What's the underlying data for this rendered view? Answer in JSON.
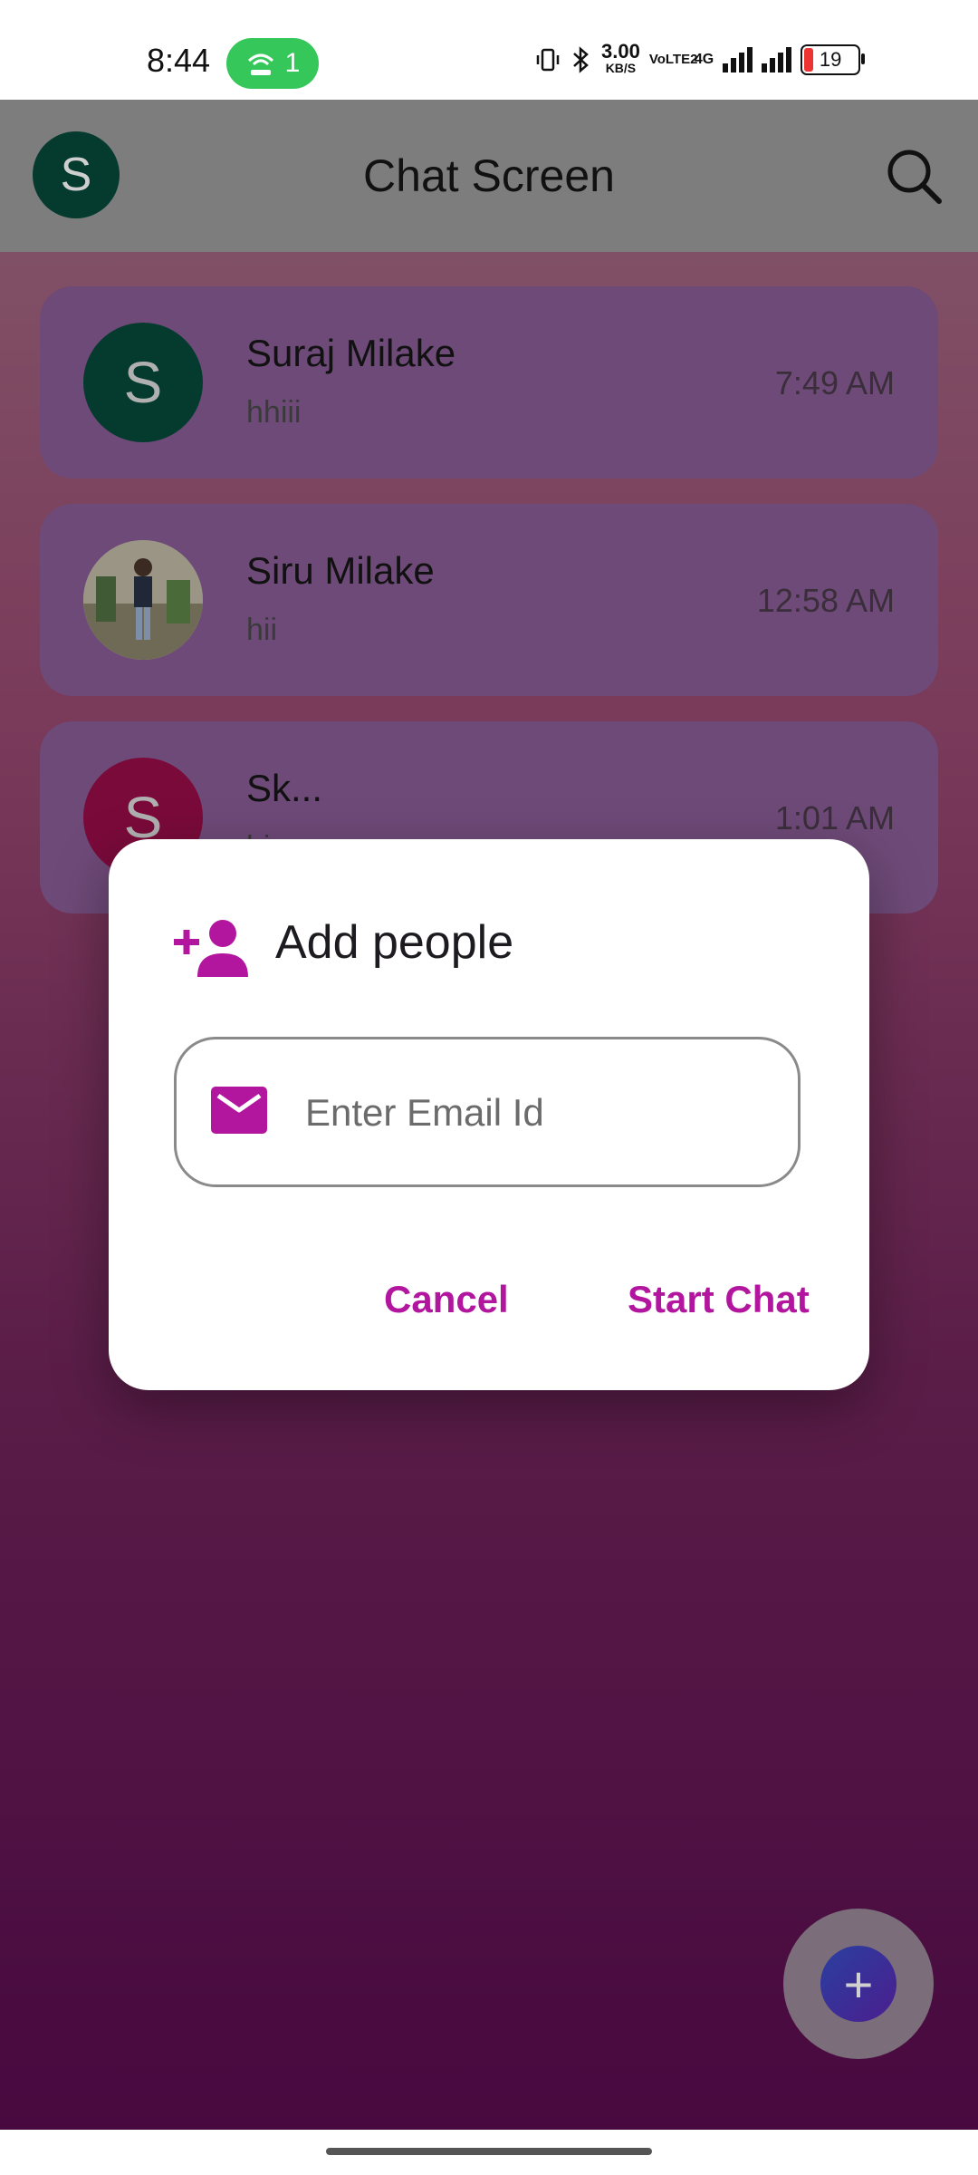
{
  "status_bar": {
    "time": "8:44",
    "hotspot_count": "1",
    "net_speed": "3.00",
    "net_speed_unit": "KB/S",
    "volte": "VoLTE2",
    "network": "4G",
    "battery": "19"
  },
  "app_bar": {
    "avatar_letter": "S",
    "title": "Chat Screen",
    "search_icon": "search-icon"
  },
  "chats": [
    {
      "name": "Suraj Milake",
      "message": "hhiii",
      "time": "7:49 AM",
      "avatar": "S",
      "avatar_color": "#053b2e"
    },
    {
      "name": "Siru Milake",
      "message": "hii",
      "time": "12:58 AM",
      "avatar": "",
      "avatar_color": "#a8a08a"
    },
    {
      "name": "Sk...",
      "message": "hi",
      "time": "1:01 AM",
      "avatar": "S",
      "avatar_color": "#7a0a3a"
    }
  ],
  "dialog": {
    "icon": "person-add-icon",
    "title": "Add people",
    "email_icon": "mail-icon",
    "email_placeholder": "Enter Email Id",
    "email_value": "",
    "cancel_label": "Cancel",
    "start_label": "Start Chat"
  },
  "fab": {
    "icon": "plus-icon",
    "label": "+"
  },
  "colors": {
    "accent": "#b3169e",
    "appbar": "#7d7d7d"
  }
}
